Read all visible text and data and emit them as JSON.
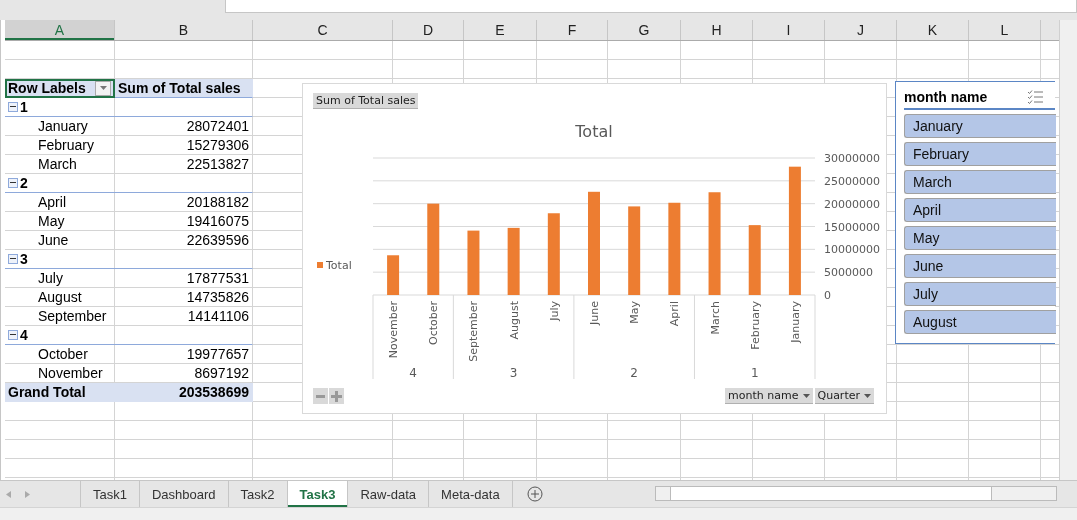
{
  "columns": [
    {
      "label": "A",
      "selected": true
    },
    {
      "label": "B",
      "selected": false
    },
    {
      "label": "C",
      "selected": false
    },
    {
      "label": "D",
      "selected": false
    },
    {
      "label": "E",
      "selected": false
    },
    {
      "label": "F",
      "selected": false
    },
    {
      "label": "G",
      "selected": false
    },
    {
      "label": "H",
      "selected": false
    },
    {
      "label": "I",
      "selected": false
    },
    {
      "label": "J",
      "selected": false
    },
    {
      "label": "K",
      "selected": false
    },
    {
      "label": "L",
      "selected": false
    }
  ],
  "pivot": {
    "header": {
      "label": "Row Labels",
      "value": "Sum of Total sales"
    },
    "groups": [
      {
        "label": "1",
        "expanded": true,
        "rows": [
          {
            "label": "January",
            "value": "28072401"
          },
          {
            "label": "February",
            "value": "15279306"
          },
          {
            "label": "March",
            "value": "22513827"
          }
        ]
      },
      {
        "label": "2",
        "expanded": true,
        "rows": [
          {
            "label": "April",
            "value": "20188182"
          },
          {
            "label": "May",
            "value": "19416075"
          },
          {
            "label": "June",
            "value": "22639596"
          }
        ]
      },
      {
        "label": "3",
        "expanded": true,
        "rows": [
          {
            "label": "July",
            "value": "17877531"
          },
          {
            "label": "August",
            "value": "14735826"
          },
          {
            "label": "September",
            "value": "14141106"
          }
        ]
      },
      {
        "label": "4",
        "expanded": true,
        "rows": [
          {
            "label": "October",
            "value": "19977657"
          },
          {
            "label": "November",
            "value": "8697192"
          }
        ]
      }
    ],
    "grand_total": {
      "label": "Grand Total",
      "value": "203538699"
    }
  },
  "chart": {
    "value_button": "Sum of Total sales",
    "axis_buttons": [
      "month name",
      "Quarter"
    ],
    "quarter_groups": [
      {
        "label": "4"
      },
      {
        "label": "3"
      },
      {
        "label": "2"
      },
      {
        "label": "1"
      }
    ],
    "chart_data": {
      "type": "bar",
      "title": "Total",
      "categories": [
        "November",
        "October",
        "September",
        "August",
        "July",
        "June",
        "May",
        "April",
        "March",
        "February",
        "January"
      ],
      "series": [
        {
          "name": "Total",
          "color": "#ed7d31",
          "values": [
            8700000,
            20000000,
            14100000,
            14700000,
            17900000,
            22600000,
            19400000,
            20200000,
            22500000,
            15300000,
            28100000
          ]
        }
      ],
      "grid": true,
      "ylim": [
        0,
        30000000
      ],
      "yticks": [
        0,
        5000000,
        10000000,
        15000000,
        20000000,
        25000000,
        30000000
      ]
    }
  },
  "slicer": {
    "title": "month name",
    "items": [
      {
        "label": "January",
        "selected": true
      },
      {
        "label": "February",
        "selected": true
      },
      {
        "label": "March",
        "selected": true
      },
      {
        "label": "April",
        "selected": true
      },
      {
        "label": "May",
        "selected": true
      },
      {
        "label": "June",
        "selected": true
      },
      {
        "label": "July",
        "selected": true
      },
      {
        "label": "August",
        "selected": true
      }
    ]
  },
  "sheet_tabs": [
    {
      "label": "Task1",
      "selected": false
    },
    {
      "label": "Dashboard",
      "selected": false
    },
    {
      "label": "Task2",
      "selected": false
    },
    {
      "label": "Task3",
      "selected": true
    },
    {
      "label": "Raw-data",
      "selected": false
    },
    {
      "label": "Meta-data",
      "selected": false
    }
  ]
}
